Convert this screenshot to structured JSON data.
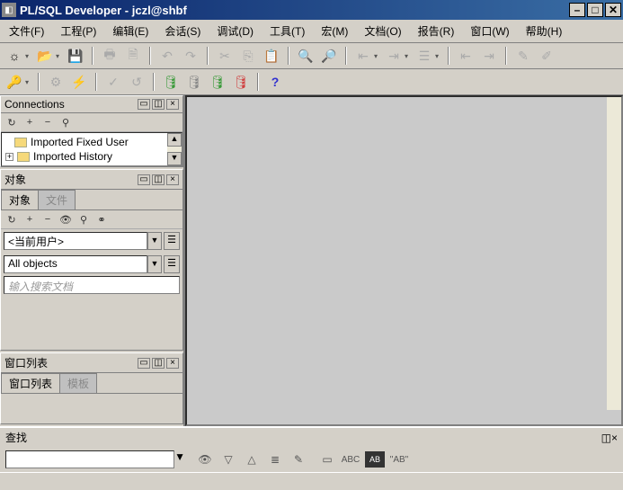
{
  "title": "PL/SQL Developer - jczl@shbf",
  "menu": {
    "file": "文件(F)",
    "project": "工程(P)",
    "edit": "编辑(E)",
    "session": "会话(S)",
    "debug": "调试(D)",
    "tools": "工具(T)",
    "macro": "宏(M)",
    "doc": "文档(O)",
    "report": "报告(R)",
    "window": "窗口(W)",
    "help": "帮助(H)"
  },
  "panes": {
    "connections": {
      "title": "Connections",
      "tree": [
        "Imported Fixed User",
        "Imported History"
      ]
    },
    "objects": {
      "title": "对象",
      "tabs": [
        "对象",
        "文件"
      ],
      "user_dropdown": "<当前用户>",
      "filter_dropdown": "All objects",
      "search_placeholder": "输入搜索文档"
    },
    "windows": {
      "title": "窗口列表",
      "tabs": [
        "窗口列表",
        "模板"
      ]
    }
  },
  "search": {
    "title": "查找",
    "ab_label": "\"AB\""
  }
}
